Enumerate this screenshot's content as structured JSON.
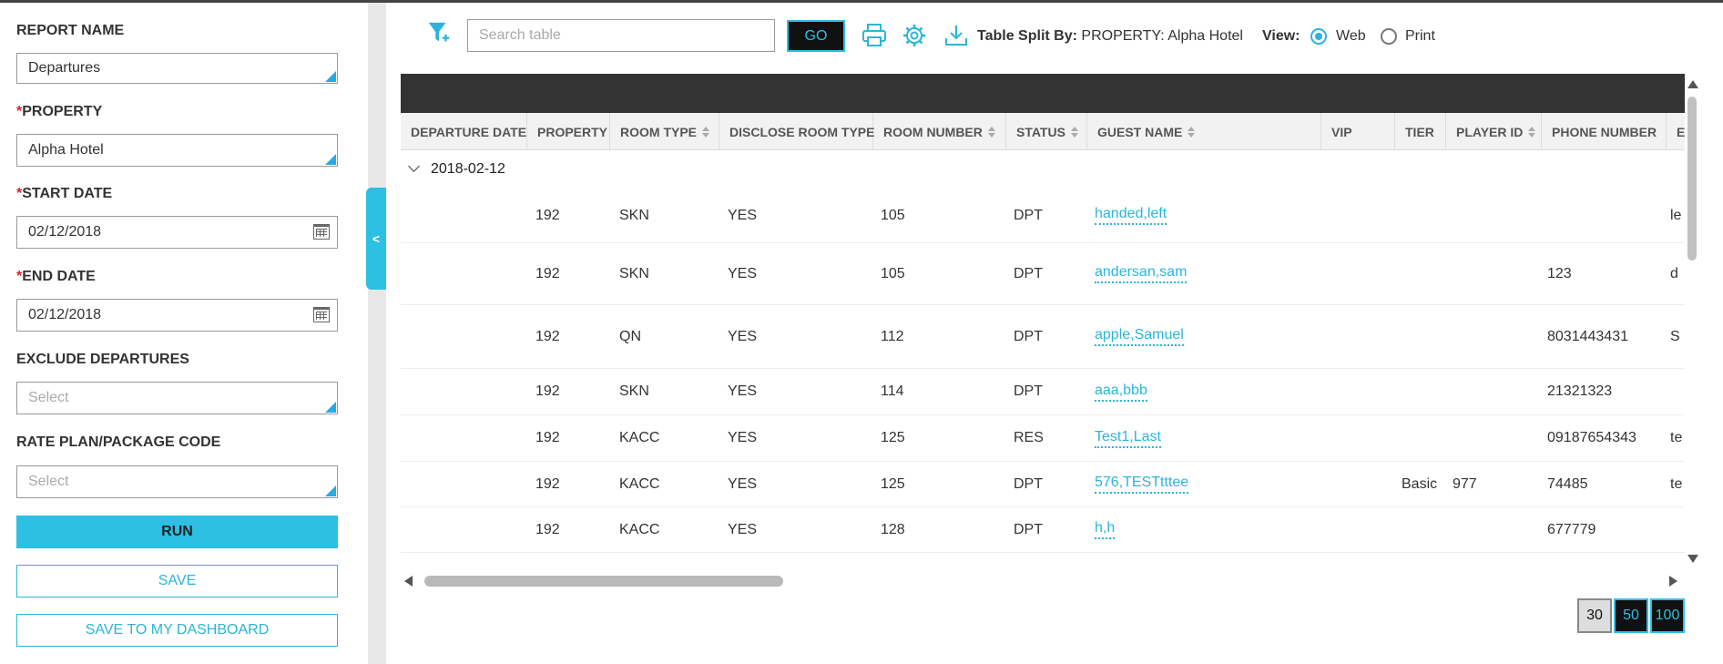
{
  "sidebar": {
    "report_name_label": "REPORT NAME",
    "report_name_value": "Departures",
    "property_label": "PROPERTY",
    "property_value": "Alpha Hotel",
    "start_date_label": "START DATE",
    "start_date_value": "02/12/2018",
    "end_date_label": "END DATE",
    "end_date_value": "02/12/2018",
    "exclude_label": "EXCLUDE DEPARTURES",
    "exclude_placeholder": "Select",
    "rateplan_label": "RATE PLAN/PACKAGE CODE",
    "rateplan_placeholder": "Select",
    "required_mark": "*",
    "run_label": "RUN",
    "save_label": "SAVE",
    "dashboard_label": "SAVE TO MY DASHBOARD",
    "collapse_glyph": "<"
  },
  "toolbar": {
    "search_placeholder": "Search table",
    "go_label": "GO",
    "split_label": "Table Split By:",
    "split_value": "PROPERTY: Alpha Hotel",
    "view_label": "View:",
    "view_web": "Web",
    "view_print": "Print",
    "view_selected": "Web",
    "icons": [
      "filter-add-icon",
      "print-icon",
      "gear-icon",
      "download-icon"
    ]
  },
  "table": {
    "columns": [
      "DEPARTURE DATE",
      "PROPERTY",
      "ROOM TYPE",
      "DISCLOSE ROOM TYPE",
      "ROOM NUMBER",
      "STATUS",
      "GUEST NAME",
      "VIP",
      "TIER",
      "PLAYER ID",
      "PHONE NUMBER",
      "E"
    ],
    "group": "2018-02-12",
    "rows": [
      {
        "property": "192",
        "room_type": "SKN",
        "disclose": "YES",
        "room_number": "105",
        "status": "DPT",
        "guest": "handed,left",
        "vip": "",
        "tier": "",
        "player_id": "",
        "phone": "",
        "extra": "le"
      },
      {
        "property": "192",
        "room_type": "SKN",
        "disclose": "YES",
        "room_number": "105",
        "status": "DPT",
        "guest": "andersan,sam",
        "vip": "",
        "tier": "",
        "player_id": "",
        "phone": "123",
        "extra": "d"
      },
      {
        "property": "192",
        "room_type": "QN",
        "disclose": "YES",
        "room_number": "112",
        "status": "DPT",
        "guest": "apple,Samuel",
        "vip": "",
        "tier": "",
        "player_id": "",
        "phone": "8031443431",
        "extra": "S"
      },
      {
        "property": "192",
        "room_type": "SKN",
        "disclose": "YES",
        "room_number": "114",
        "status": "DPT",
        "guest": "aaa,bbb",
        "vip": "",
        "tier": "",
        "player_id": "",
        "phone": "21321323",
        "extra": ""
      },
      {
        "property": "192",
        "room_type": "KACC",
        "disclose": "YES",
        "room_number": "125",
        "status": "RES",
        "guest": "Test1,Last",
        "vip": "",
        "tier": "",
        "player_id": "",
        "phone": "09187654343",
        "extra": "te"
      },
      {
        "property": "192",
        "room_type": "KACC",
        "disclose": "YES",
        "room_number": "125",
        "status": "DPT",
        "guest": "576,TESTtttee",
        "vip": "",
        "tier": "Basic",
        "player_id": "977",
        "phone": "74485",
        "extra": "te"
      },
      {
        "property": "192",
        "room_type": "KACC",
        "disclose": "YES",
        "room_number": "128",
        "status": "DPT",
        "guest": "h,h",
        "vip": "",
        "tier": "",
        "player_id": "",
        "phone": "677779",
        "extra": ""
      }
    ]
  },
  "pagination": {
    "sizes": [
      "30",
      "50",
      "100"
    ],
    "selected": "30"
  },
  "colors": {
    "accent": "#2bc0e4",
    "link": "#2bb5d8",
    "required": "#d9222a",
    "header_bar": "#333333"
  }
}
